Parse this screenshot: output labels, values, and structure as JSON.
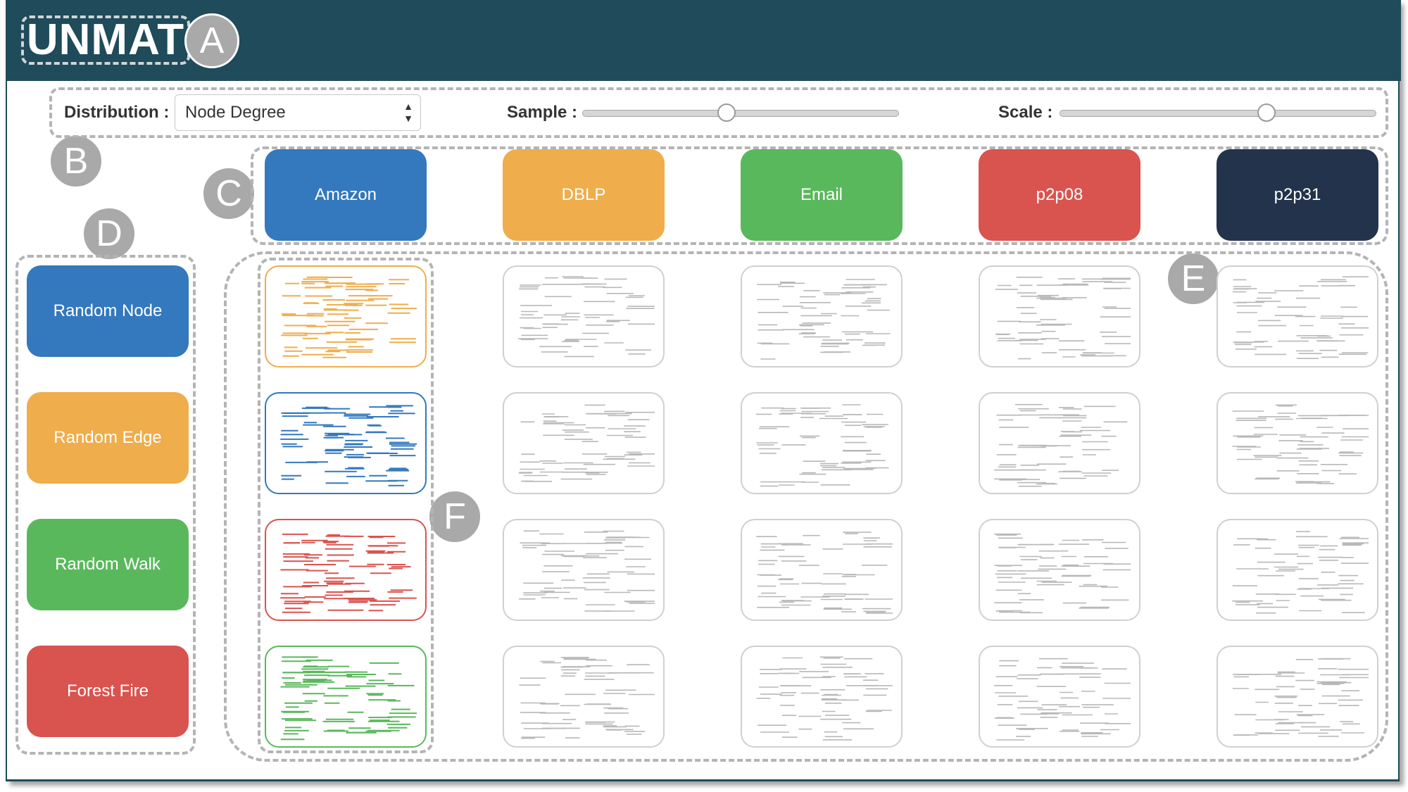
{
  "app": {
    "title": "UNMAT"
  },
  "annotations": [
    "A",
    "B",
    "C",
    "D",
    "E",
    "F"
  ],
  "controls": {
    "distribution_label": "Distribution",
    "distribution_value": "Node Degree",
    "sample_label": "Sample",
    "sample_value": 0.45,
    "scale_label": "Scale",
    "scale_value": 0.66
  },
  "datasets": [
    {
      "label": "Amazon",
      "color": "#3478bd"
    },
    {
      "label": "DBLP",
      "color": "#efad4c"
    },
    {
      "label": "Email",
      "color": "#5ab85c"
    },
    {
      "label": "p2p08",
      "color": "#d9534f"
    },
    {
      "label": "p2p31",
      "color": "#23334b"
    }
  ],
  "algorithms": [
    {
      "label": "Random Node",
      "color": "#3478bd"
    },
    {
      "label": "Random Edge",
      "color": "#efad4c"
    },
    {
      "label": "Random Walk",
      "color": "#5ab85c"
    },
    {
      "label": "Forest Fire",
      "color": "#d9534f"
    }
  ],
  "grid": {
    "highlight_colors": [
      "#efad4c",
      "#3478bd",
      "#d9534f",
      "#5ab85c"
    ],
    "neutral_color": "#b8b8b8"
  }
}
